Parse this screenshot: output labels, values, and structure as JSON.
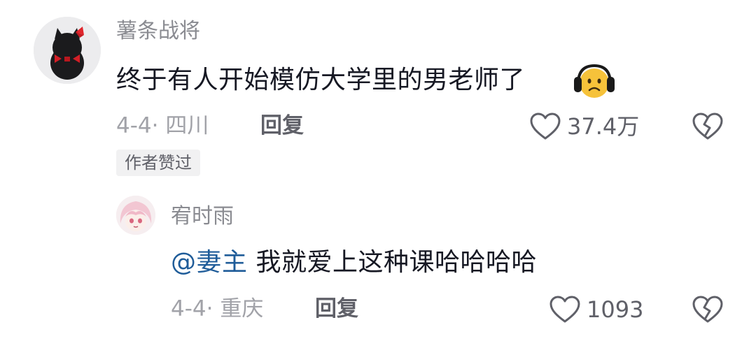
{
  "comment": {
    "username": "薯条战将",
    "text": "终于有人开始模仿大学里的男老师了",
    "emoji_icon": "headphones-worried-face-emoji",
    "date": "4-4",
    "separator": "·",
    "location": "四川",
    "reply_label": "回复",
    "like_count": "37.4万",
    "badge": "作者赞过"
  },
  "reply": {
    "username": "宥时雨",
    "mention": "@妻主",
    "text": "我就爱上这种课哈哈哈哈",
    "date": "4-4",
    "separator": "·",
    "location": "重庆",
    "reply_label": "回复",
    "like_count": "1093"
  },
  "colors": {
    "text_primary": "#161823",
    "text_secondary": "#8a8b91",
    "meta": "#a1a2a8",
    "mention": "#1f5c99",
    "badge_bg": "#f1f1f2"
  }
}
